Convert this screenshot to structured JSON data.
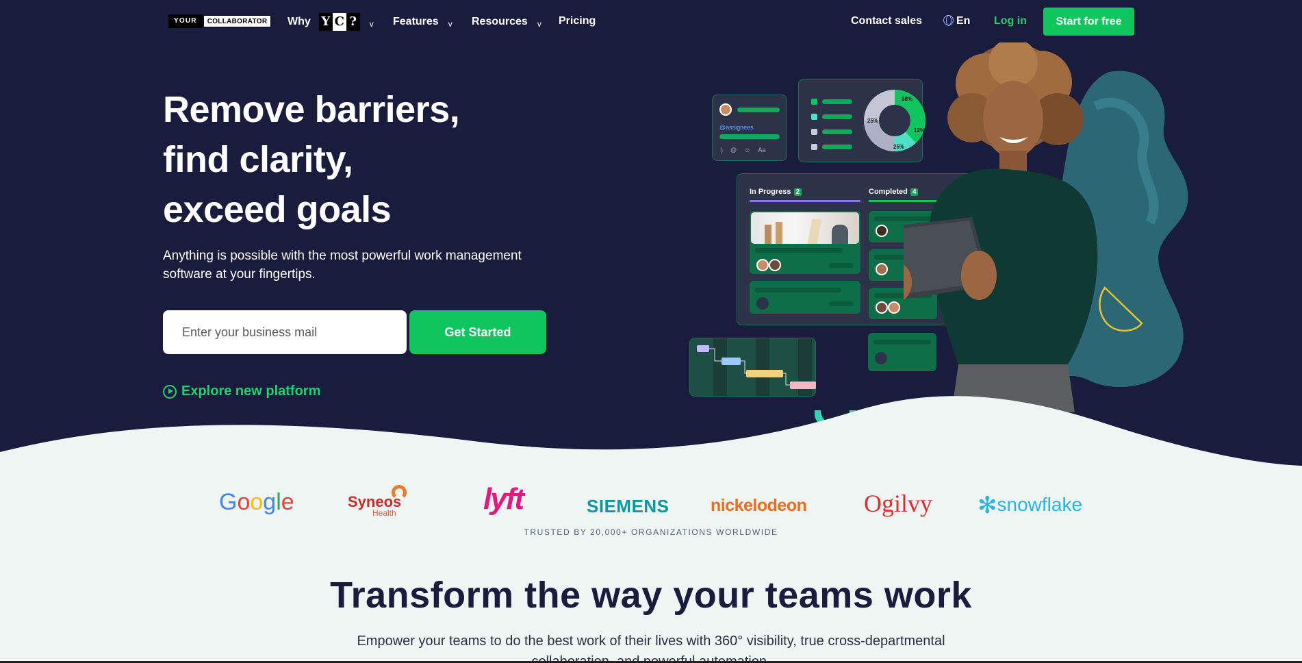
{
  "nav": {
    "logo_part1": "YOUR",
    "logo_part2": "COLLABORATOR",
    "why_label": "Why",
    "why_badge": [
      "Y",
      "C",
      "?"
    ],
    "features_label": "Features",
    "resources_label": "Resources",
    "pricing_label": "Pricing",
    "contact_label": "Contact sales",
    "language_label": "En",
    "login_label": "Log in",
    "start_label": "Start for free",
    "chevron": "v"
  },
  "hero": {
    "headline_lines": [
      "Remove barriers,",
      "find clarity,",
      "exceed goals"
    ],
    "subtitle": "Anything is possible with the most powerful work management software at your fingertips.",
    "email_placeholder": "Enter your business mail",
    "cta_label": "Get Started",
    "explore_label": "Explore new platform"
  },
  "illustration": {
    "assignees_label": "@assignees",
    "toolbar_icons": [
      ")",
      "@",
      "☺",
      "Aa"
    ],
    "donut_labels": [
      "38%",
      "12%",
      "25%",
      "25%"
    ],
    "in_progress_label": "In Progress",
    "in_progress_count": "2",
    "completed_label": "Completed",
    "completed_count": "4"
  },
  "logos": {
    "google": "Google",
    "syneos": "Syneos",
    "syneos_sub": "Health",
    "lyft": "lyft",
    "siemens": "SIEMENS",
    "nickelodeon": "nickelodeon",
    "ogilvy": "Ogilvy",
    "snowflake": "snowflake",
    "trusted": "TRUSTED BY 20,000+ ORGANIZATIONS WORLDWIDE"
  },
  "section": {
    "title": "Transform the way your teams work",
    "body": "Empower your teams to do the best work of their lives with 360° visibility, true cross-departmental collaboration, and powerful automation."
  },
  "colors": {
    "hero_bg": "#191c3c",
    "accent_green": "#0fc65e",
    "light_bg": "#eef5f3"
  }
}
